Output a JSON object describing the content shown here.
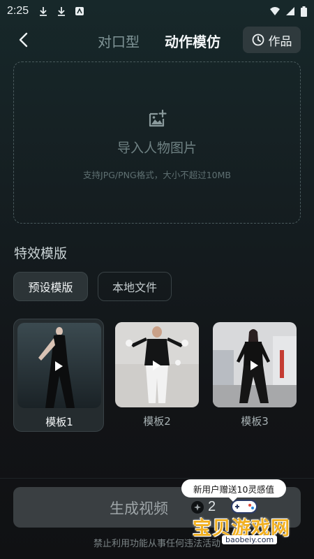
{
  "status_bar": {
    "time": "2:25"
  },
  "header": {
    "tab_lip_sync": "对口型",
    "tab_motion": "动作模仿",
    "works_label": "作品"
  },
  "upload": {
    "title": "导入人物图片",
    "subtitle": "支持JPG/PNG格式，大小不超过10MB"
  },
  "effects": {
    "section_title": "特效模版",
    "tab_preset": "预设模版",
    "tab_local": "本地文件",
    "templates": [
      {
        "label": "模板1",
        "selected": true
      },
      {
        "label": "模板2",
        "selected": false
      },
      {
        "label": "模板3",
        "selected": false
      }
    ]
  },
  "bottom": {
    "generate_label": "生成视频",
    "cost": "2",
    "promo_tip": "新用户赠送10灵感值",
    "footer_note": "禁止利用功能从事任何违法活动"
  },
  "watermark": {
    "title": "宝贝游戏网",
    "url": "baobeiy.com"
  },
  "colors": {
    "accent_gold": "#f1b021",
    "background": "#121417",
    "button": "#3a3f42"
  }
}
